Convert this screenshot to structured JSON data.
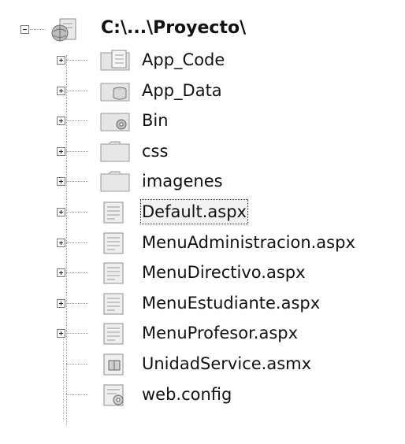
{
  "root": {
    "label": "C:\\...\\Proyecto\\",
    "icon": "web-project-icon",
    "expanded": true
  },
  "items": [
    {
      "label": "App_Code",
      "icon": "special-folder-icon",
      "expandable": true
    },
    {
      "label": "App_Data",
      "icon": "data-folder-icon",
      "expandable": true
    },
    {
      "label": "Bin",
      "icon": "bin-folder-icon",
      "expandable": true
    },
    {
      "label": "css",
      "icon": "folder-icon",
      "expandable": true
    },
    {
      "label": "imagenes",
      "icon": "folder-icon",
      "expandable": true
    },
    {
      "label": "Default.aspx",
      "icon": "aspx-page-icon",
      "expandable": true,
      "selected": true
    },
    {
      "label": "MenuAdministracion.aspx",
      "icon": "aspx-page-icon",
      "expandable": true
    },
    {
      "label": "MenuDirectivo.aspx",
      "icon": "aspx-page-icon",
      "expandable": true
    },
    {
      "label": "MenuEstudiante.aspx",
      "icon": "aspx-page-icon",
      "expandable": true
    },
    {
      "label": "MenuProfesor.aspx",
      "icon": "aspx-page-icon",
      "expandable": true
    },
    {
      "label": "UnidadService.asmx",
      "icon": "web-service-icon",
      "expandable": false
    },
    {
      "label": "web.config",
      "icon": "config-file-icon",
      "expandable": false
    }
  ]
}
